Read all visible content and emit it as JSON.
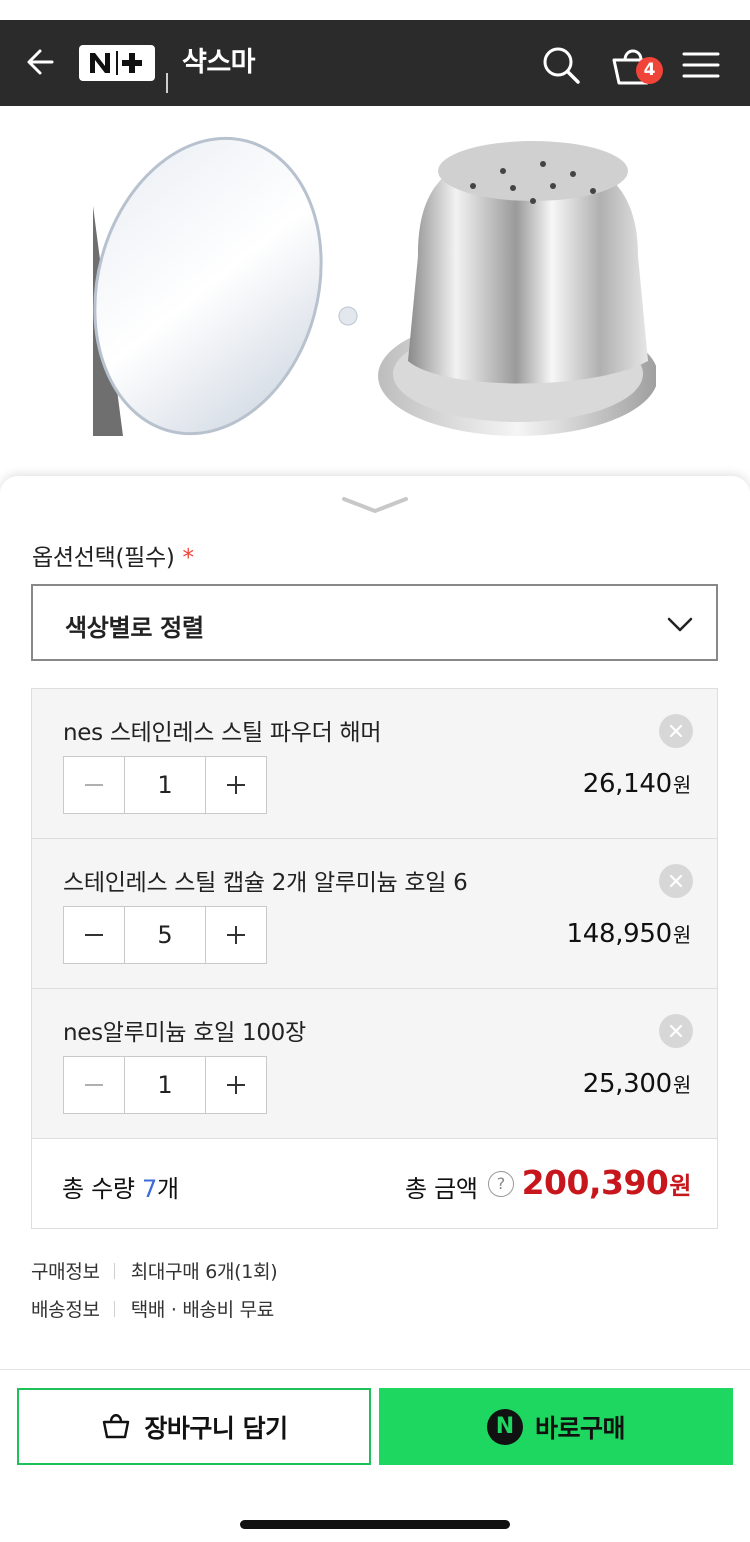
{
  "header": {
    "logo_text": "N+",
    "store_name": "샥스마",
    "cart_count": "4",
    "background": "#2b2b2b"
  },
  "options": {
    "label": "옵션선택(필수)",
    "required_mark": "*",
    "select_value": "색상별로 정렬"
  },
  "items": [
    {
      "name": "nes 스테인레스 스틸 파우더 해머",
      "qty": "1",
      "price": "26,140",
      "currency": "원"
    },
    {
      "name": "스테인레스 스틸 캡슐 2개 알루미늄 호일 6",
      "qty": "5",
      "price": "148,950",
      "currency": "원"
    },
    {
      "name": "nes알루미늄 호일 100장",
      "qty": "1",
      "price": "25,300",
      "currency": "원"
    }
  ],
  "totals": {
    "qty_label": "총 수량",
    "qty_value": "7",
    "qty_unit": "개",
    "amount_label": "총 금액",
    "help_symbol": "?",
    "amount_value": "200,390",
    "currency": "원"
  },
  "info": {
    "purchase_label": "구매정보",
    "purchase_value": "최대구매 6개(1회)",
    "shipping_label": "배송정보",
    "shipping_value": "택배 · 배송비 무료"
  },
  "actions": {
    "cart_label": "장바구니 담기",
    "buy_label": "바로구매",
    "buy_badge": "N"
  },
  "colors": {
    "accent_green": "#1ed760",
    "price_red": "#c8161d",
    "count_blue": "#3d6bd9",
    "badge_red": "#f04438"
  },
  "icons": [
    "back-arrow-icon",
    "search-icon",
    "shopping-bag-icon",
    "hamburger-menu-icon",
    "chevron-down-icon",
    "close-icon",
    "minus-icon",
    "plus-icon",
    "help-icon"
  ]
}
